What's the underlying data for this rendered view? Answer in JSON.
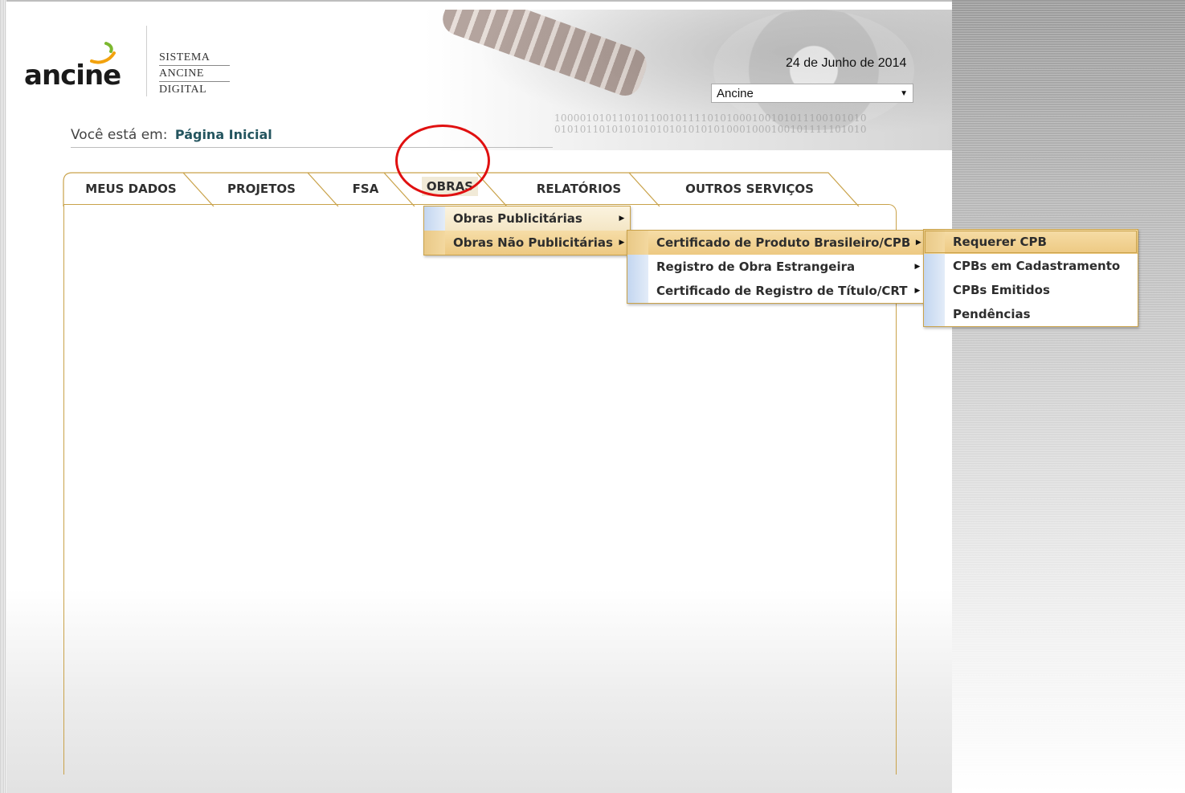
{
  "header": {
    "logo_text": "ancine",
    "logo_subtitle_lines": [
      "SISTEMA",
      "ANCINE",
      "DIGITAL"
    ],
    "binary_line1": "1000010101101011001011110101000100101011100101010",
    "binary_line2": "0101011010101010101010101010001000100101111101010",
    "date": "24 de Junho de 2014",
    "entity_select": {
      "value": "Ancine"
    }
  },
  "breadcrumb": {
    "prefix": "Você está em:",
    "current": "Página Inicial"
  },
  "tabs": [
    {
      "label": "MEUS DADOS"
    },
    {
      "label": "PROJETOS"
    },
    {
      "label": "FSA"
    },
    {
      "label": "OBRAS"
    },
    {
      "label": "RELATÓRIOS"
    },
    {
      "label": "OUTROS SERVIÇOS"
    }
  ],
  "menu_level1": [
    {
      "label": "Obras Publicitárias"
    },
    {
      "label": "Obras Não Publicitárias"
    }
  ],
  "menu_level2": [
    {
      "label": "Certificado de Produto Brasileiro/CPB"
    },
    {
      "label": "Registro de Obra Estrangeira"
    },
    {
      "label": "Certificado de Registro de Título/CRT"
    }
  ],
  "menu_level3": [
    {
      "label": "Requerer CPB"
    },
    {
      "label": "CPBs em Cadastramento"
    },
    {
      "label": "CPBs Emitidos"
    },
    {
      "label": "Pendências"
    }
  ],
  "colors": {
    "accent_border": "#c9a24a",
    "menu_highlight": "#edc982",
    "annotation": "#e01010",
    "breadcrumb_link": "#24555f"
  }
}
